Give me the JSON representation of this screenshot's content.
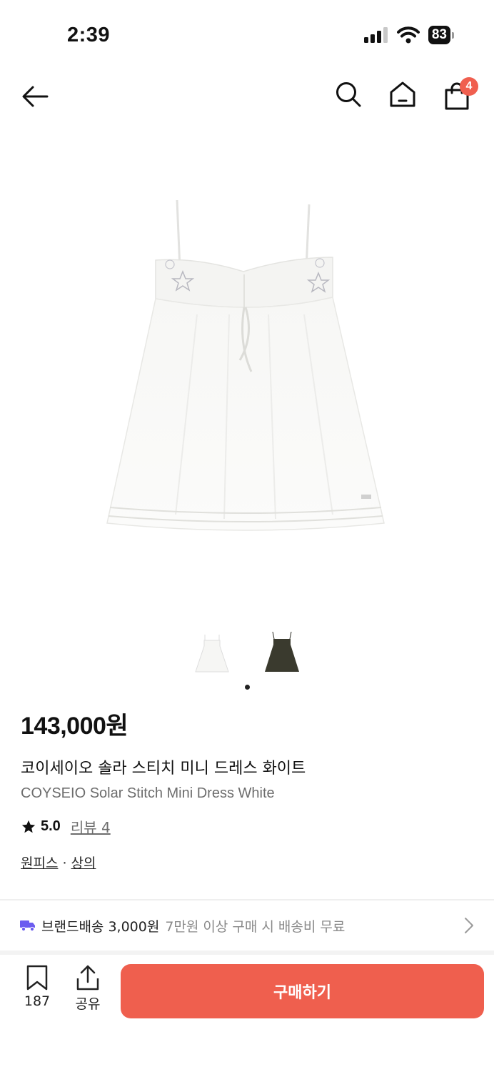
{
  "status_bar": {
    "time": "2:39",
    "battery": "83"
  },
  "nav": {
    "cart_count": "4"
  },
  "gallery": {
    "thumbnails": [
      "white-dress",
      "dark-dress"
    ],
    "active_index": 0
  },
  "product": {
    "price": "143,000원",
    "name_ko": "코이세이오 솔라 스티치 미니 드레스 화이트",
    "name_en": "COYSEIO Solar Stitch Mini Dress White",
    "rating": "5.0",
    "review_label": "리뷰 4",
    "categories": [
      "원피스",
      "상의"
    ],
    "category_separator": "·"
  },
  "shipping": {
    "label": "브랜드배송 3,000원",
    "note": "7만원 이상 구매 시 배송비 무료"
  },
  "bottom_bar": {
    "like_count": "187",
    "share_label": "공유",
    "buy_label": "구매하기"
  },
  "colors": {
    "accent": "#ef5f4e",
    "badge": "#f05f4f",
    "truck_icon": "#6b5cf0",
    "muted_text": "#6d6d6d"
  }
}
